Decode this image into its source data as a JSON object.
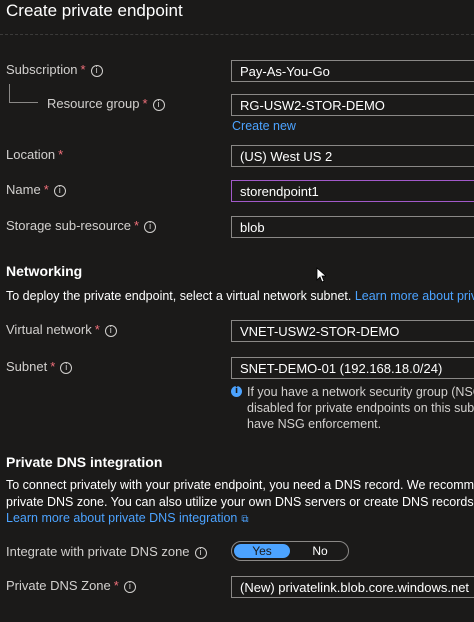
{
  "header": {
    "title": "Create private endpoint"
  },
  "fields": {
    "subscription": {
      "label": "Subscription",
      "value": "Pay-As-You-Go"
    },
    "resource_group": {
      "label": "Resource group",
      "value": "RG-USW2-STOR-DEMO",
      "create_new": "Create new"
    },
    "location": {
      "label": "Location",
      "value": "(US) West US 2"
    },
    "name": {
      "label": "Name",
      "value": "storendpoint1"
    },
    "sub_resource": {
      "label": "Storage sub-resource",
      "value": "blob"
    }
  },
  "networking": {
    "heading": "Networking",
    "description": "To deploy the private endpoint, select a virtual network subnet.",
    "learn_more": "Learn more about private e",
    "virtual_network": {
      "label": "Virtual network",
      "value": "VNET-USW2-STOR-DEMO"
    },
    "subnet": {
      "label": "Subnet",
      "value": "SNET-DEMO-01 (192.168.18.0/24)"
    },
    "note_lines": [
      "If you have a network security group (NSG",
      "disabled for private endpoints on this subn",
      "have NSG enforcement."
    ]
  },
  "dns": {
    "heading": "Private DNS integration",
    "desc_line1": "To connect privately with your private endpoint, you need a DNS record. We recommend th",
    "desc_line2": "private DNS zone. You can also utilize your own DNS servers or create DNS records using t",
    "learn_more": "Learn more about private DNS integration",
    "integrate": {
      "label": "Integrate with private DNS zone",
      "yes": "Yes",
      "no": "No",
      "selected": "Yes"
    },
    "zone": {
      "label": "Private DNS Zone",
      "value": "(New) privatelink.blob.core.windows.net"
    }
  },
  "icons": {
    "info": "info-icon",
    "note": "info-filled-icon",
    "external": "external-link-icon",
    "cursor": "mouse-pointer-icon"
  },
  "colors": {
    "background": "#1b1a19",
    "link": "#4ca3ff",
    "required": "#f1707b",
    "active_border": "#a259c9"
  }
}
